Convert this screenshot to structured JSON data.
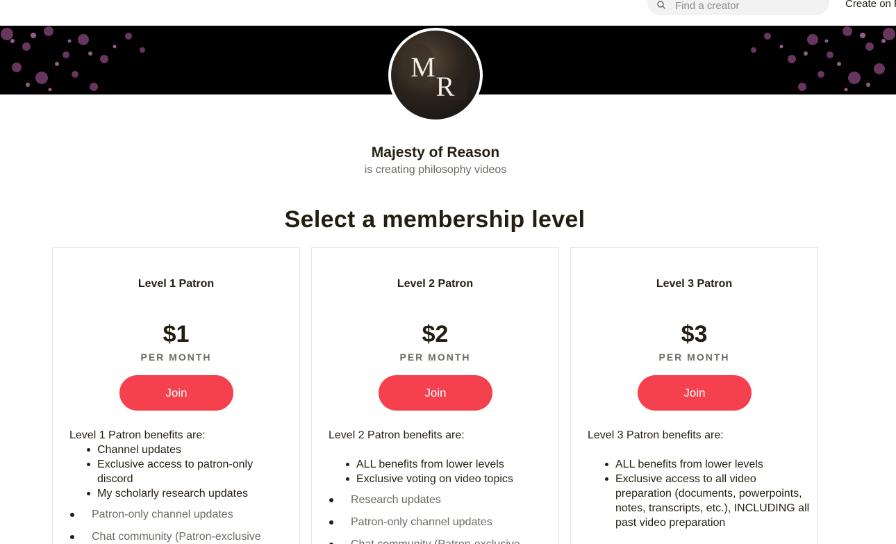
{
  "nav": {
    "search_placeholder": "Find a creator",
    "create_link": "Create on P"
  },
  "creator": {
    "monogram": "MR",
    "name": "Majesty of Reason",
    "tagline": "is creating philosophy videos"
  },
  "section_title": "Select a membership level",
  "tiers": [
    {
      "name": "Level 1 Patron",
      "price": "$1",
      "period": "PER MONTH",
      "join_label": "Join",
      "intro": "Level 1 Patron benefits are:",
      "benefits": [
        "Channel updates",
        "Exclusive access to patron-only discord",
        "My scholarly research updates"
      ],
      "extras": [
        "Patron-only channel updates",
        "Chat community (Patron-exclusive"
      ]
    },
    {
      "name": "Level 2 Patron",
      "price": "$2",
      "period": "PER MONTH",
      "join_label": "Join",
      "intro": "Level 2 Patron benefits are:",
      "benefits": [
        "ALL benefits from lower levels",
        "Exclusive voting on video topics"
      ],
      "extras": [
        "Research updates",
        "Patron-only channel updates",
        "Chat community (Patron-exclusive"
      ]
    },
    {
      "name": "Level 3 Patron",
      "price": "$3",
      "period": "PER MONTH",
      "join_label": "Join",
      "intro": "Level 3 Patron benefits are:",
      "benefits": [
        "ALL benefits from lower levels",
        "Exclusive access to all video preparation (documents, powerpoints, notes, transcripts, etc.), INCLUDING all past video preparation"
      ],
      "extras": []
    }
  ],
  "colors": {
    "accent": "#f5414d",
    "text": "#241e12",
    "muted": "#6e6a63",
    "banner": "#000000"
  },
  "icons": {
    "search": "search-icon"
  }
}
